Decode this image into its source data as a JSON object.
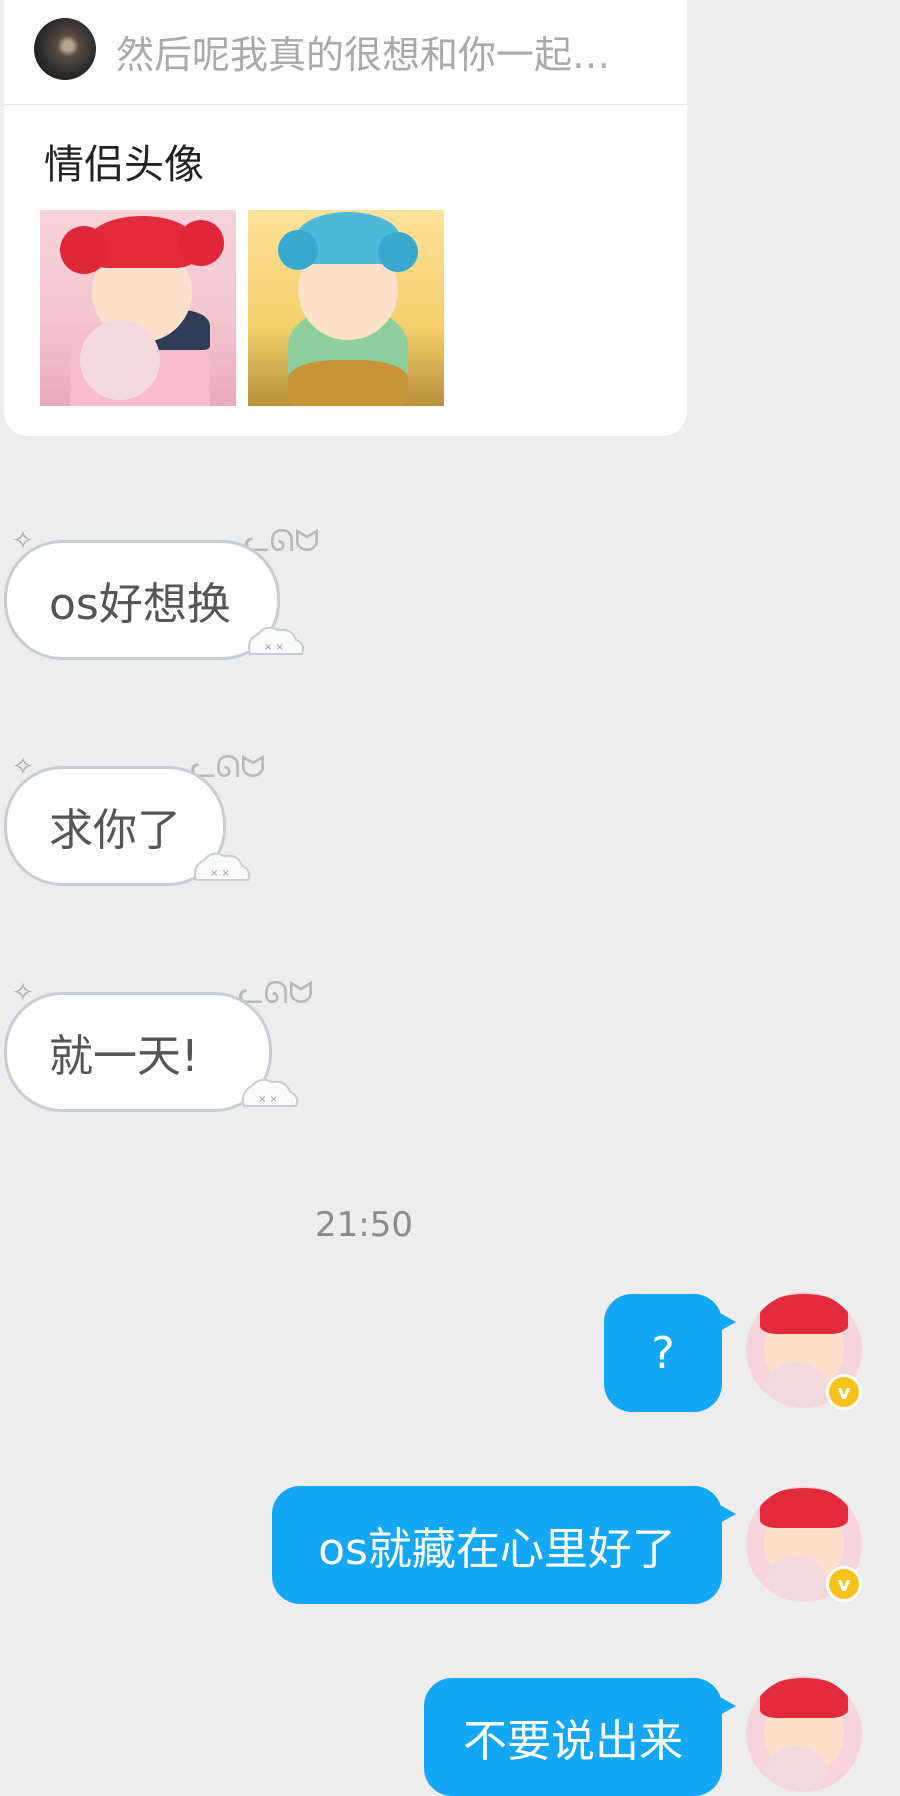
{
  "shared_card": {
    "header_text": "然后呢我真的很想和你一起…",
    "title": "情侣头像"
  },
  "messages_received": [
    {
      "text": "os好想换"
    },
    {
      "text": "求你了"
    },
    {
      "text": "就一天!"
    }
  ],
  "timestamp": "21:50",
  "messages_sent": [
    {
      "text": "?"
    },
    {
      "text": "os就藏在心里好了"
    },
    {
      "text": "不要说出来"
    }
  ],
  "badge": {
    "label": "v"
  },
  "colors": {
    "background": "#ededed",
    "sent_bubble": "#14a7f5",
    "received_border": "#c8ccd4",
    "vip_badge": "#f6c21a"
  }
}
